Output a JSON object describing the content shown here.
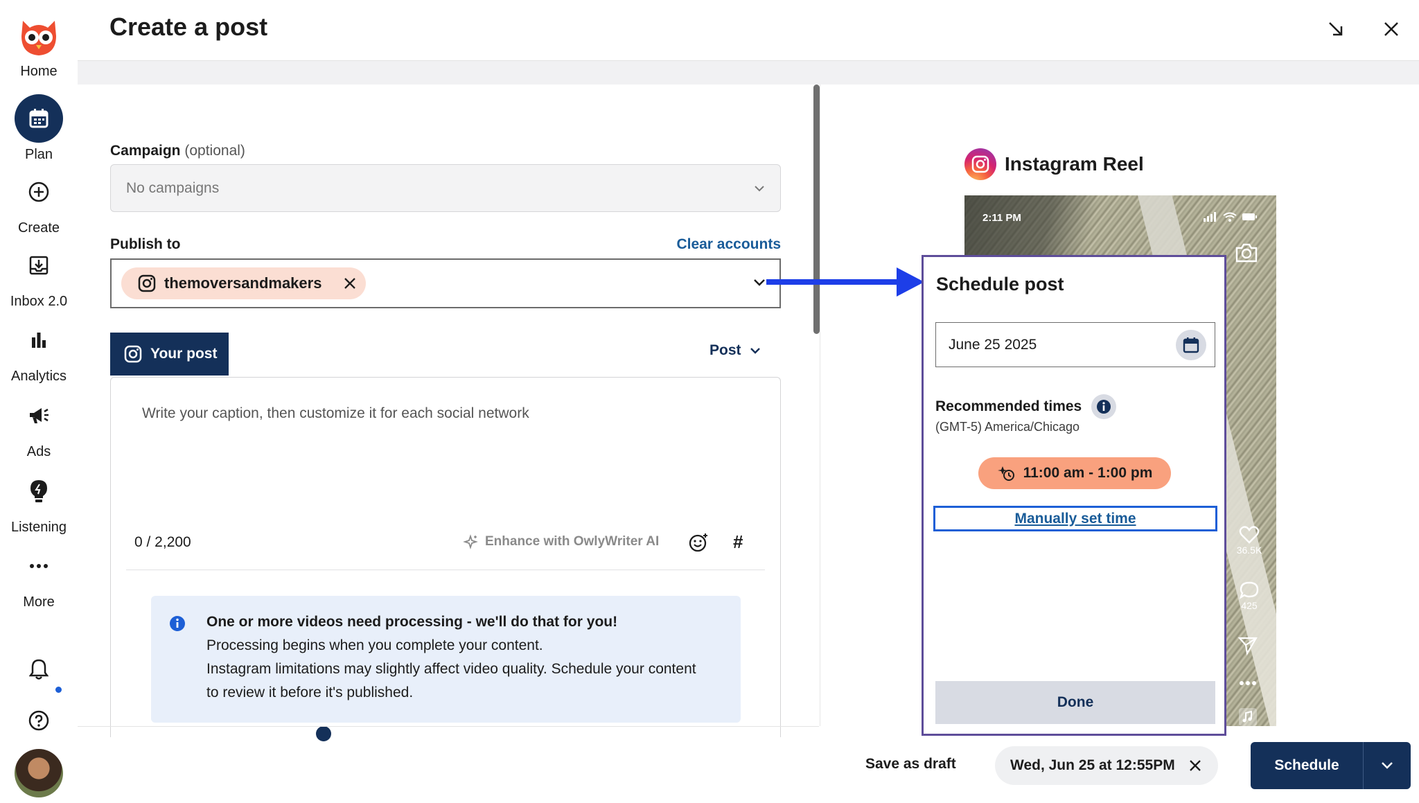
{
  "sidebar": {
    "items": [
      {
        "label": "Home",
        "icon": "owl-logo-icon"
      },
      {
        "label": "Plan",
        "icon": "calendar-icon"
      },
      {
        "label": "Create",
        "icon": "plus-circle-icon"
      },
      {
        "label": "Inbox 2.0",
        "icon": "inbox-icon"
      },
      {
        "label": "Analytics",
        "icon": "bar-chart-icon"
      },
      {
        "label": "Ads",
        "icon": "megaphone-icon"
      },
      {
        "label": "Listening",
        "icon": "lightbulb-icon"
      },
      {
        "label": "More",
        "icon": "more-dots-icon"
      }
    ],
    "active_item": "Plan"
  },
  "header": {
    "title": "Create a post",
    "minimize_icon": "minimize-arrow-icon",
    "close_icon": "close-icon"
  },
  "composer": {
    "campaign_label": "Campaign",
    "campaign_optional": "(optional)",
    "campaign_value": "No campaigns",
    "publish_label": "Publish to",
    "clear_accounts": "Clear accounts",
    "account": "themoversandmakers",
    "tab_your_post": "Your post",
    "post_type": "Post",
    "caption_placeholder": "Write your caption, then customize it for each social network",
    "char_count": "0 / 2,200",
    "enhance": "Enhance with OwlyWriter AI",
    "hashtag": "#",
    "info_title": "One or more videos need processing - we'll do that for you!",
    "info_line1": "Processing begins when you complete your content.",
    "info_line2": "Instagram limitations may slightly affect video quality. Schedule your content",
    "info_line3": "to review it before it's published."
  },
  "preview": {
    "title": "Instagram Reel",
    "time": "2:11 PM",
    "likes": "36.5K",
    "comments": "425"
  },
  "schedule_popup": {
    "title": "Schedule post",
    "date": "June 25 2025",
    "recommended_label": "Recommended times",
    "timezone": "(GMT-5) America/Chicago",
    "recommended_time": "11:00 am - 1:00 pm",
    "manual_link": "Manually set time",
    "done": "Done"
  },
  "footer": {
    "save_draft": "Save as draft",
    "scheduled_date": "Wed, Jun 25 at 12:55PM",
    "schedule": "Schedule"
  },
  "colors": {
    "navy": "#143059",
    "link_blue": "#1a5c99",
    "arrow_blue": "#1d3ee8",
    "chip_peach": "#fbded3",
    "time_pill": "#f9a17e",
    "popup_border": "#5e4d9a",
    "info_bg": "#e8effa"
  }
}
